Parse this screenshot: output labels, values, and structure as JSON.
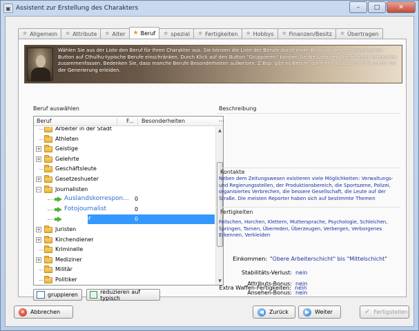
{
  "window": {
    "title": "Assistent zur Erstellung des Charakters",
    "controls": {
      "minimize": "–",
      "maximize": "□",
      "close": "✕"
    }
  },
  "tabs": [
    {
      "label": "Allgemein",
      "active": false
    },
    {
      "label": "Attribute",
      "active": false
    },
    {
      "label": "Alter",
      "active": false
    },
    {
      "label": "Beruf",
      "active": true
    },
    {
      "label": "spezial",
      "active": false
    },
    {
      "label": "Fertigkeiten",
      "active": false
    },
    {
      "label": "Hobbys",
      "active": false
    },
    {
      "label": "Finanzen/Besitz",
      "active": false
    },
    {
      "label": "Übertragen",
      "active": false
    }
  ],
  "banner": {
    "text": "Wählen Sie aus der Liste den Beruf für Ihren Charakter aus. Sie können die Liste der Berufe durch einen Klick auf den entsprechenden Button auf Cthulhu-typische Berufe einschränken. Durch Klick auf den Button \"Gruppieren\" können Sie die Liste der Berufe nach Kategorien zusammenfassen. Bedenken Sie, dass manche Berufe Besonderheiten aufweisen. Z.Bsp. gibt es Berufe, die einen Abzug von STA schon bei der Generierung erleiden."
  },
  "left": {
    "section_label": "Beruf auswählen",
    "columns": [
      "Beruf",
      "F...",
      "Besonderheiten"
    ],
    "rows": [
      {
        "label": "Arbeiter in der Stadt",
        "expander": "",
        "type": "folder",
        "level": 0
      },
      {
        "label": "Athleten",
        "expander": "",
        "type": "folder",
        "level": 0
      },
      {
        "label": "Geistige",
        "expander": "+",
        "type": "folder",
        "level": 0
      },
      {
        "label": "Gelehrte",
        "expander": "+",
        "type": "folder",
        "level": 0
      },
      {
        "label": "Geschäftsleute",
        "expander": "",
        "type": "folder",
        "level": 0
      },
      {
        "label": "Gesetzeshueter",
        "expander": "+",
        "type": "folder",
        "level": 0
      },
      {
        "label": "Journalisten",
        "expander": "-",
        "type": "folder",
        "level": 0
      },
      {
        "label": "Auslandskorrespon...",
        "value": "0",
        "type": "job",
        "level": 1,
        "selected": false
      },
      {
        "label": "Fotojournalist",
        "value": "0",
        "type": "job",
        "level": 1,
        "selected": false
      },
      {
        "label": "Reporter",
        "value": "0",
        "type": "job",
        "level": 1,
        "selected": true
      },
      {
        "label": "Juristen",
        "expander": "+",
        "type": "folder",
        "level": 0
      },
      {
        "label": "Kirchendiener",
        "expander": "+",
        "type": "folder",
        "level": 0
      },
      {
        "label": "Kriminelle",
        "expander": "",
        "type": "folder",
        "level": 0
      },
      {
        "label": "Mediziner",
        "expander": "+",
        "type": "folder",
        "level": 0
      },
      {
        "label": "Militär",
        "expander": "",
        "type": "folder",
        "level": 0
      },
      {
        "label": "Politiker",
        "expander": "",
        "type": "folder",
        "level": 0
      }
    ],
    "group_button": "gruppieren",
    "reduce_button": "reduzieren auf typisch"
  },
  "right": {
    "description_label": "Beschreibung",
    "description_value": "...",
    "contacts_label": "Kontakte",
    "contacts_text": "Neben dem Zeitungswesen existieren viele Möglichkeiten: Verwaltungs- und Regierungsstellen, der Produktionsbereich, die Sportszene, Polizei, organisiertes Verbrechen, die bessere Gesellschaft, die Leute auf der Straße. Die meisten Reporter haben sich auf bestimmte Themen",
    "skills_label": "Fertigkeiten",
    "skills_text": "Feilschen, Horchen, Klettern, Muttersprache, Psychologie, Schleichen, Springen, Tarnen, Überreden, Überzeugen, Verbergen, Verborgenes Erkennen, Verkleiden",
    "income_label": "Einkommen:",
    "income_value": "\"Obere Arbeiterschicht\" bis \"Mittelschicht\"",
    "stats": [
      {
        "label": "Stabilitäts-Verlust:",
        "value": "nein"
      },
      {
        "label": "Attributs-Bonus:",
        "value": "nein"
      },
      {
        "label": "Ansehen-Bonus:",
        "value": "nein"
      },
      {
        "label": "Extra Waffen-Fertigkeiten:",
        "value": "nein"
      }
    ]
  },
  "footer": {
    "cancel": "Abbrechen",
    "back": "Zurück",
    "next": "Weiter",
    "finish": "Fertigstellen"
  }
}
